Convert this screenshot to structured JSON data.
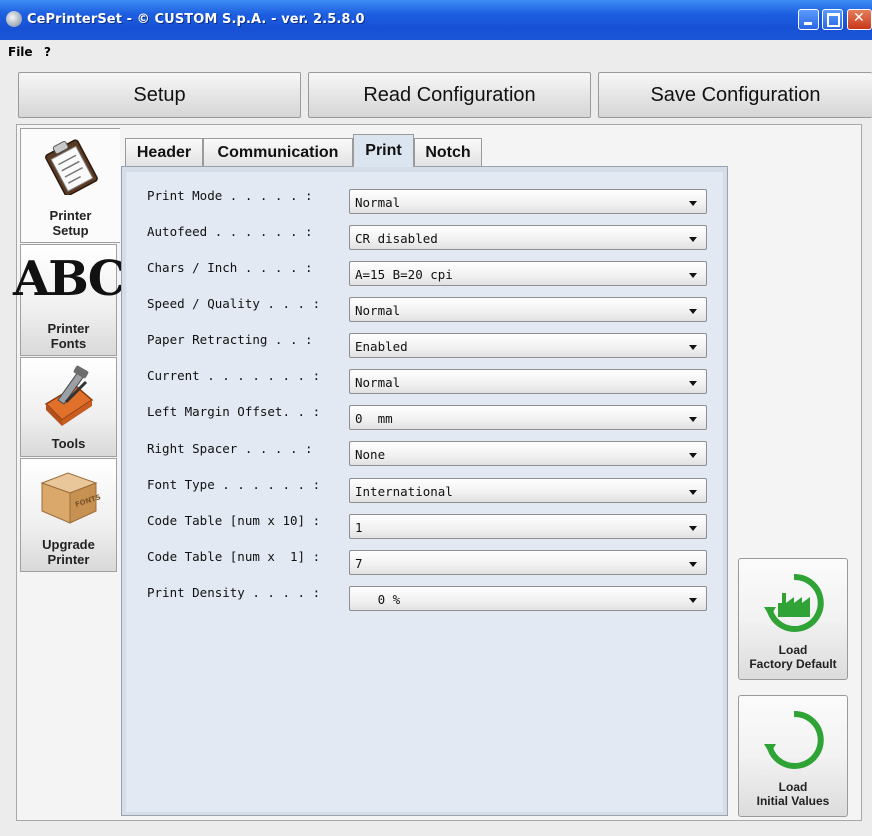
{
  "window": {
    "title": "CePrinterSet - © CUSTOM S.p.A. - ver. 2.5.8.0"
  },
  "menu": {
    "file": "File",
    "help": "?"
  },
  "toolbar": {
    "setup": "Setup",
    "read": "Read Configuration",
    "save": "Save Configuration"
  },
  "sidebar": {
    "items": [
      {
        "line1": "Printer",
        "line2": "Setup",
        "icon": "clipboard-icon"
      },
      {
        "line1": "Printer",
        "line2": "Fonts",
        "icon": "abc-font-icon",
        "glyph": "ABC"
      },
      {
        "line1": "Tools",
        "line2": "",
        "icon": "toolbox-icon"
      },
      {
        "line1": "Upgrade",
        "line2": "Printer",
        "icon": "fonts-box-icon",
        "box_text": "FONTS"
      }
    ]
  },
  "tabs": [
    {
      "label": "Header"
    },
    {
      "label": "Communication"
    },
    {
      "label": "Print"
    },
    {
      "label": "Notch"
    }
  ],
  "settings": [
    {
      "label": "Print Mode . . . . . :",
      "value": "Normal"
    },
    {
      "label": "Autofeed . . . . . . :",
      "value": "CR disabled"
    },
    {
      "label": "Chars / Inch . . . . :",
      "value": "A=15 B=20 cpi"
    },
    {
      "label": "Speed / Quality . . . :",
      "value": "Normal"
    },
    {
      "label": "Paper Retracting . . :",
      "value": "Enabled"
    },
    {
      "label": "Current . . . . . . . :",
      "value": "Normal"
    },
    {
      "label": "Left Margin Offset. . :",
      "value": "0  mm"
    },
    {
      "label": "Right Spacer . . . . :",
      "value": "None"
    },
    {
      "label": "Font Type . . . . . . :",
      "value": "International"
    },
    {
      "label": "Code Table [num x 10] :",
      "value": "1"
    },
    {
      "label": "Code Table [num x  1] :",
      "value": "7"
    },
    {
      "label": "Print Density . . . . :",
      "value": "   0 %"
    }
  ],
  "side_buttons": {
    "factory": {
      "line1": "Load",
      "line2": "Factory Default"
    },
    "initial": {
      "line1": "Load",
      "line2": "Initial Values"
    }
  }
}
